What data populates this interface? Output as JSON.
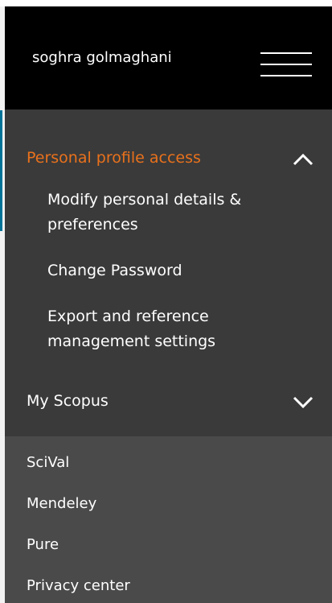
{
  "header": {
    "user_name": "soghra golmaghani",
    "menu_icon": "hamburger-menu-icon"
  },
  "nav": {
    "groups": [
      {
        "label": "Personal profile access",
        "expanded": true,
        "chevron_icon": "chevron-up-icon",
        "items": [
          {
            "label": "Modify personal details & preferences"
          },
          {
            "label": "Change Password"
          },
          {
            "label": "Export and reference management settings"
          }
        ]
      },
      {
        "label": "My Scopus",
        "expanded": false,
        "chevron_icon": "chevron-down-icon",
        "items": []
      }
    ]
  },
  "links": [
    {
      "label": "SciVal"
    },
    {
      "label": "Mendeley"
    },
    {
      "label": "Pure"
    },
    {
      "label": "Privacy center"
    }
  ],
  "colors": {
    "header_bg": "#000000",
    "panel_bg": "#3a3a3a",
    "links_bg": "#4a4a4a",
    "active_label": "#e9711c",
    "text": "#ffffff",
    "accent_bar": "#007398"
  }
}
